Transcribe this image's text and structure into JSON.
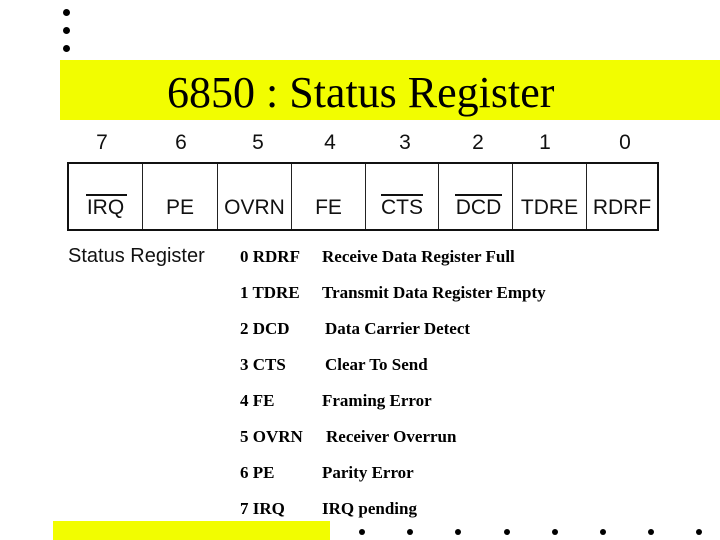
{
  "slide": {
    "title": "6850 : Status Register",
    "accent_color": "#f2fd00",
    "register": {
      "bit_numbers": [
        "7",
        "6",
        "5",
        "4",
        "3",
        "2",
        "1",
        "0"
      ],
      "cells": [
        {
          "label": "IRQ",
          "overbar": true
        },
        {
          "label": "PE",
          "overbar": false
        },
        {
          "label": "OVRN",
          "overbar": false
        },
        {
          "label": "FE",
          "overbar": false
        },
        {
          "label": "CTS",
          "overbar": true
        },
        {
          "label": "DCD",
          "overbar": true
        },
        {
          "label": "TDRE",
          "overbar": false
        },
        {
          "label": "RDRF",
          "overbar": false
        }
      ],
      "caption": "Status Register"
    },
    "bit_descriptions": [
      {
        "code": "0 RDRF",
        "description": "Receive Data Register Full"
      },
      {
        "code": "1 TDRE",
        "description": "Transmit Data Register Empty"
      },
      {
        "code": "2 DCD",
        "description": "Data Carrier Detect"
      },
      {
        "code": "3 CTS",
        "description": "Clear To Send"
      },
      {
        "code": "4 FE",
        "description": "Framing Error"
      },
      {
        "code": "5 OVRN",
        "description": "Receiver Overrun"
      },
      {
        "code": "6 PE",
        "description": "Parity Error"
      },
      {
        "code": "7 IRQ",
        "description": "IRQ pending"
      }
    ]
  }
}
